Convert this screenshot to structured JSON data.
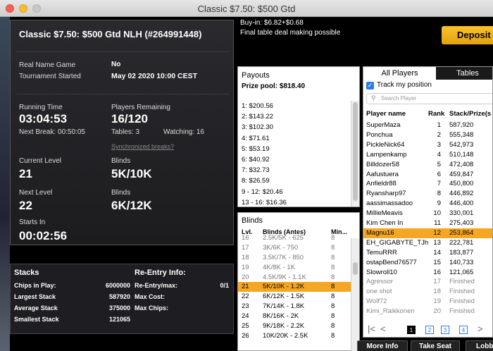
{
  "window": {
    "title": "Classic $7.50: $500 Gtd"
  },
  "info": {
    "title": "Classic $7.50: $500 Gtd NLH (#264991448)",
    "real_name_label": "Real Name Game",
    "real_name_value": "No",
    "started_label": "Tournament Started",
    "started_value": "May 02 2020 10:00 CEST",
    "running_label": "Running Time",
    "running_value": "03:04:53",
    "next_break_label": "Next Break:",
    "next_break_value": "00:50:05",
    "players_label": "Players Remaining",
    "players_value": "16/120",
    "tables_label": "Tables:",
    "tables_value": "3",
    "watching_label": "Watching:",
    "watching_value": "16",
    "sync_link": "Synchronized breaks?",
    "current_level_label": "Current Level",
    "current_level_value": "21",
    "blinds_label": "Blinds",
    "current_blinds_value": "5K/10K",
    "next_level_label": "Next Level",
    "next_level_value": "22",
    "next_blinds_label": "Blinds",
    "next_blinds_value": "6K/12K",
    "starts_in_label": "Starts In",
    "starts_in_value": "00:02:56"
  },
  "stacks": {
    "heading": "Stacks",
    "rows": [
      {
        "label": "Chips in Play:",
        "value": "6000000"
      },
      {
        "label": "Largest Stack",
        "value": "587920"
      },
      {
        "label": "Average Stack",
        "value": "375000"
      },
      {
        "label": "Smallest Stack",
        "value": "121065"
      }
    ],
    "reentry_heading": "Re-Entry Info:",
    "reentry_rows": [
      {
        "label": "Re-Entry/max:",
        "value": "0/1"
      },
      {
        "label": "Max Cost:",
        "value": ""
      },
      {
        "label": "Max Chips:",
        "value": ""
      }
    ]
  },
  "header": {
    "buyin": "Buy-in: $6.82+$0.68",
    "deal": "Final table deal making possible",
    "deposit": "Deposit"
  },
  "payouts": {
    "heading": "Payouts",
    "pool": "Prize pool: $818.40",
    "items": [
      "1: $200.56",
      "2: $143.22",
      "3: $102.30",
      "4: $71.61",
      "5: $53.19",
      "6: $40.92",
      "7: $32.73",
      "8: $26.59",
      "9 - 12: $20.46",
      "13 - 16: $16.36"
    ]
  },
  "blinds": {
    "heading": "Blinds",
    "columns": [
      "Lvl.",
      "Blinds (Antes)",
      "Min..."
    ],
    "rows": [
      {
        "lvl": "16",
        "blinds": "2.5K/5K - 625",
        "min": "8",
        "state": "dim"
      },
      {
        "lvl": "17",
        "blinds": "3K/6K - 750",
        "min": "8",
        "state": "dim"
      },
      {
        "lvl": "18",
        "blinds": "3.5K/7K - 850",
        "min": "8",
        "state": "dim"
      },
      {
        "lvl": "19",
        "blinds": "4K/8K - 1K",
        "min": "8",
        "state": "dim"
      },
      {
        "lvl": "20",
        "blinds": "4.5K/9K - 1.1K",
        "min": "8",
        "state": "dim"
      },
      {
        "lvl": "21",
        "blinds": "5K/10K - 1.2K",
        "min": "8",
        "state": "hl"
      },
      {
        "lvl": "22",
        "blinds": "6K/12K - 1.5K",
        "min": "8",
        "state": ""
      },
      {
        "lvl": "23",
        "blinds": "7K/14K - 1.8K",
        "min": "8",
        "state": ""
      },
      {
        "lvl": "24",
        "blinds": "8K/16K - 2K",
        "min": "8",
        "state": ""
      },
      {
        "lvl": "25",
        "blinds": "9K/18K - 2.2K",
        "min": "8",
        "state": ""
      },
      {
        "lvl": "26",
        "blinds": "10K/20K - 2.5K",
        "min": "8",
        "state": ""
      }
    ]
  },
  "players": {
    "tab_all": "All Players",
    "tab_tables": "Tables",
    "track_label": "Track my position",
    "search_placeholder": "Search Player",
    "columns": [
      "Player name",
      "Rank",
      "Stack/Prize(s"
    ],
    "rows": [
      {
        "name": "SuperMaza",
        "rank": "1",
        "stack": "587,920",
        "state": ""
      },
      {
        "name": "Ponchua",
        "rank": "2",
        "stack": "555,348",
        "state": ""
      },
      {
        "name": "PickleNick64",
        "rank": "3",
        "stack": "542,973",
        "state": ""
      },
      {
        "name": "Lampenkamp",
        "rank": "4",
        "stack": "510,148",
        "state": ""
      },
      {
        "name": "Billdozer58",
        "rank": "5",
        "stack": "472,408",
        "state": ""
      },
      {
        "name": "Aafustuera",
        "rank": "6",
        "stack": "459,847",
        "state": ""
      },
      {
        "name": "Anfieldr88",
        "rank": "7",
        "stack": "450,800",
        "state": ""
      },
      {
        "name": "Ryansharp97",
        "rank": "8",
        "stack": "446,892",
        "state": ""
      },
      {
        "name": "aassimassadoo",
        "rank": "9",
        "stack": "446,400",
        "state": ""
      },
      {
        "name": "MillieMeavis",
        "rank": "10",
        "stack": "330,001",
        "state": ""
      },
      {
        "name": "Kim Chen In",
        "rank": "11",
        "stack": "275,403",
        "state": ""
      },
      {
        "name": "Magnu16",
        "rank": "12",
        "stack": "253,864",
        "state": "hl"
      },
      {
        "name": "EH_GIGABYTE_TJh",
        "rank": "13",
        "stack": "222,781",
        "state": ""
      },
      {
        "name": "TemuRRR",
        "rank": "14",
        "stack": "183,877",
        "state": ""
      },
      {
        "name": "ostapBend76577",
        "rank": "15",
        "stack": "140,733",
        "state": ""
      },
      {
        "name": "Slowroll10",
        "rank": "16",
        "stack": "121,065",
        "state": ""
      },
      {
        "name": "Agressor",
        "rank": "17",
        "stack": "Finished",
        "state": "dim"
      },
      {
        "name": "one shot",
        "rank": "18",
        "stack": "Finished",
        "state": "dim"
      },
      {
        "name": "Wolf72",
        "rank": "19",
        "stack": "Finished",
        "state": "dim"
      },
      {
        "name": "Kimi_Raikkonen",
        "rank": "20",
        "stack": "Finished",
        "state": "dim"
      }
    ],
    "pages": [
      "1",
      "2",
      "3",
      "4"
    ]
  },
  "buttons": {
    "more_info": "More Info",
    "take_seat": "Take Seat",
    "lobby": "Lobby"
  }
}
